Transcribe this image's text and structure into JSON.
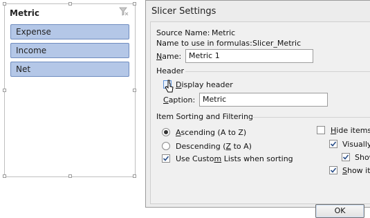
{
  "slicer": {
    "header": "Metric",
    "items": [
      {
        "label": "Expense"
      },
      {
        "label": "Income"
      },
      {
        "label": "Net"
      }
    ]
  },
  "dialog": {
    "title": "Slicer Settings",
    "source_name_label": "Source Name:",
    "source_name_value": "Metric",
    "formula_name_label": "Name to use in formulas:",
    "formula_name_value": "Slicer_Metric",
    "name_label": "Name:",
    "name_value": "Metric 1",
    "header_group": "Header",
    "display_header_label": "Display header",
    "display_header_checked": false,
    "caption_label": "Caption:",
    "caption_value": "Metric",
    "sorting_group": "Item Sorting and Filtering",
    "ascending_label": "Ascending (A to Z)",
    "descending_label": "Descending (Z to A)",
    "sort_selected": "ascending",
    "custom_lists_label": "Use Custom Lists when sorting",
    "hide_items_label": "Hide items w",
    "visually_label": "Visually",
    "show_label_1": "Show",
    "show_label_2": "Show it",
    "ok_label": "OK"
  }
}
